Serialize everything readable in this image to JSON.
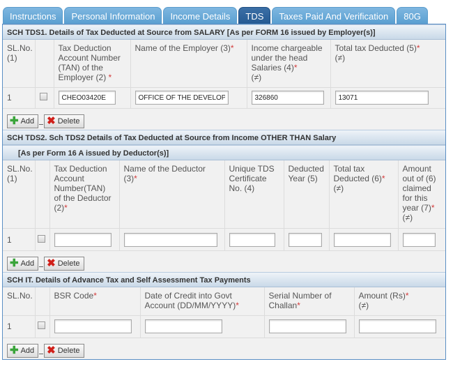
{
  "tabs": [
    {
      "label": "Instructions",
      "active": false
    },
    {
      "label": "Personal Information",
      "active": false
    },
    {
      "label": "Income Details",
      "active": false
    },
    {
      "label": "TDS",
      "active": true
    },
    {
      "label": "Taxes Paid And Verification",
      "active": false
    },
    {
      "label": "80G",
      "active": false
    }
  ],
  "tds1": {
    "title": "SCH TDS1. Details of Tax Deducted at Source from SALARY [As per FORM 16 issued by Employer(s)]",
    "headers": [
      {
        "text": "SL.No. (1)",
        "req": ""
      },
      {
        "text": "",
        "req": ""
      },
      {
        "text": "Tax Deduction Account Number (TAN) of the Employer (2)",
        "req": "*"
      },
      {
        "text": "Name of the Employer (3)",
        "req": "*"
      },
      {
        "text": "Income chargeable under the head Salaries (4)",
        "req": "*",
        "suffix": "(≠)"
      },
      {
        "text": "Total tax Deducted (5)",
        "req": "*",
        "suffix": "(≠)"
      }
    ],
    "rows": [
      {
        "sl": "1",
        "tan": "CHEO03420E",
        "employer": "OFFICE OF THE DEVELOPMENT",
        "income": "326860",
        "tax": "13071"
      }
    ]
  },
  "tds2": {
    "title": "SCH TDS2. Sch TDS2 Details of Tax Deducted at Source from Income OTHER THAN Salary",
    "subtitle": "[As per Form 16 A issued by Deductor(s)]",
    "headers": [
      {
        "text": "SL.No. (1)",
        "req": ""
      },
      {
        "text": "",
        "req": ""
      },
      {
        "text": "Tax Deduction Account Number(TAN) of the Deductor (2)",
        "req": "*"
      },
      {
        "text": "Name of the Deductor (3)",
        "req": "*"
      },
      {
        "text": "Unique TDS Certificate No. (4)",
        "req": ""
      },
      {
        "text": "Deducted Year (5)",
        "req": ""
      },
      {
        "text": "Total tax Deducted (6)",
        "req": "*",
        "suffix": "(≠)"
      },
      {
        "text": "Amount out of (6) claimed for this year (7)",
        "req": "*",
        "suffix": "(≠)"
      }
    ],
    "rows": [
      {
        "sl": "1",
        "tan": "",
        "deductor": "",
        "cert": "",
        "year": "",
        "tax": "",
        "claimed": ""
      }
    ]
  },
  "sch_it": {
    "title": "SCH IT. Details of Advance Tax and Self Assessment Tax Payments",
    "headers": [
      {
        "text": "SL.No.",
        "req": ""
      },
      {
        "text": "",
        "req": ""
      },
      {
        "text": "BSR Code",
        "req": "*"
      },
      {
        "text": "Date of Credit into Govt Account (DD/MM/YYYY)",
        "req": "*"
      },
      {
        "text": "Serial Number of Challan",
        "req": "*"
      },
      {
        "text": "Amount (Rs)",
        "req": "*",
        "suffix": "(≠)"
      }
    ],
    "rows": [
      {
        "sl": "1",
        "bsr": "",
        "date": "",
        "challan": "",
        "amount": ""
      }
    ]
  },
  "buttons": {
    "add": "Add",
    "delete": "Delete"
  },
  "colors": {
    "tab": "#5a9fd1",
    "tab_active": "#245a93",
    "required": "#d23a3a",
    "add_icon": "#3aa43a",
    "delete_icon": "#d0201a"
  }
}
